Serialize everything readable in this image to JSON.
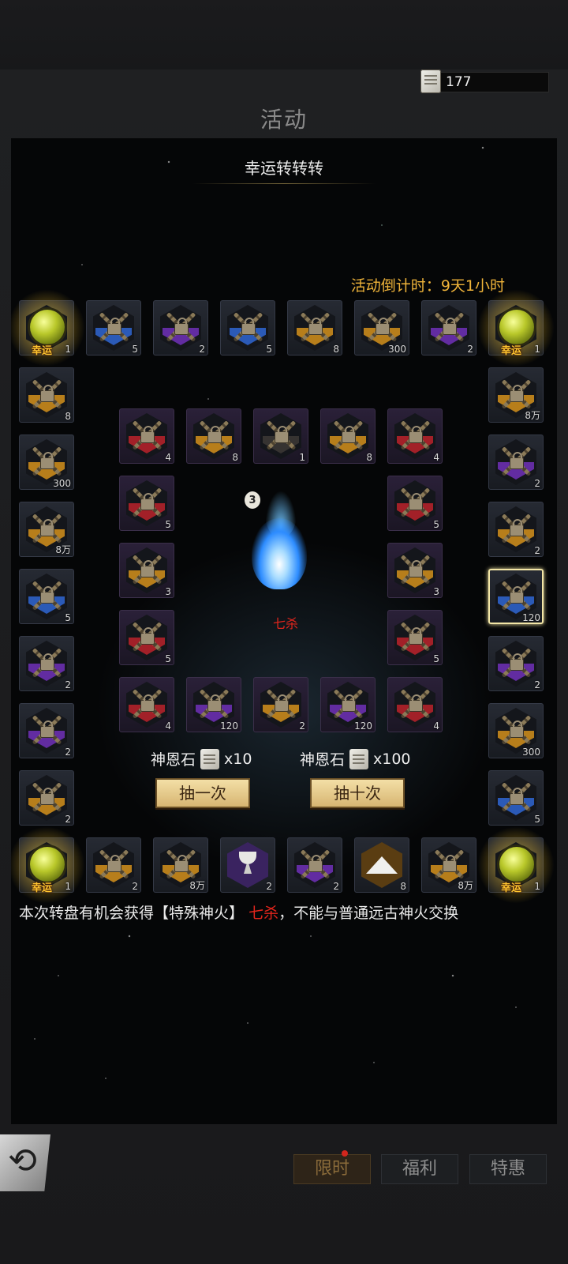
{
  "header": {
    "currency_value": "177",
    "title": "活动"
  },
  "panel": {
    "subtitle": "幸运转转转",
    "countdown_label": "活动倒计时：",
    "countdown_value": "9天1小时"
  },
  "luck_label": "幸运",
  "center": {
    "fire_level": "3",
    "fire_name": "七杀"
  },
  "draw_one": {
    "cost_label": "神恩石",
    "cost_amount": "x10",
    "button": "抽一次"
  },
  "draw_ten": {
    "cost_label": "神恩石",
    "cost_amount": "x100",
    "button": "抽十次"
  },
  "notice": {
    "before": "本次转盘有机会获得【特殊神火】",
    "highlight": "七杀",
    "after": "，不能与普通远古神火交换"
  },
  "tabs": [
    "限时",
    "福利",
    "特惠"
  ],
  "active_tab": "限时",
  "colors": {
    "gold": "#f0b43a",
    "blue": "#2e62c9",
    "purple": "#6a2fb0",
    "red": "#b1212a",
    "orange": "#c98a1c",
    "dark": "#3a3634",
    "highlight_red": "#e2251c"
  },
  "outer_ring": [
    {
      "type": "luck",
      "count": "1"
    },
    {
      "type": "locked",
      "tint": "blue",
      "count": "5"
    },
    {
      "type": "locked",
      "tint": "purple",
      "count": "2"
    },
    {
      "type": "locked",
      "tint": "blue",
      "count": "5"
    },
    {
      "type": "locked",
      "tint": "orange",
      "count": "8"
    },
    {
      "type": "locked",
      "tint": "orange",
      "count": "300"
    },
    {
      "type": "locked",
      "tint": "purple",
      "count": "2"
    },
    {
      "type": "luck",
      "count": "1"
    },
    {
      "type": "locked",
      "tint": "orange",
      "count": "8万"
    },
    {
      "type": "locked",
      "tint": "purple",
      "count": "2"
    },
    {
      "type": "locked",
      "tint": "orange",
      "count": "2"
    },
    {
      "type": "locked",
      "tint": "blue",
      "count": "120",
      "selected": true
    },
    {
      "type": "locked",
      "tint": "purple",
      "count": "2"
    },
    {
      "type": "locked",
      "tint": "orange",
      "count": "300"
    },
    {
      "type": "locked",
      "tint": "blue",
      "count": "5"
    },
    {
      "type": "luck",
      "count": "1"
    },
    {
      "type": "locked",
      "tint": "orange",
      "count": "8万"
    },
    {
      "type": "powder",
      "count": "8"
    },
    {
      "type": "locked",
      "tint": "purple",
      "count": "2"
    },
    {
      "type": "cup",
      "count": "2"
    },
    {
      "type": "locked",
      "tint": "orange",
      "count": "8万"
    },
    {
      "type": "locked",
      "tint": "orange",
      "count": "2"
    },
    {
      "type": "luck",
      "count": "1"
    },
    {
      "type": "locked",
      "tint": "orange",
      "count": "2"
    },
    {
      "type": "locked",
      "tint": "purple",
      "count": "2"
    },
    {
      "type": "locked",
      "tint": "purple",
      "count": "2"
    },
    {
      "type": "locked",
      "tint": "blue",
      "count": "5"
    },
    {
      "type": "locked",
      "tint": "orange",
      "count": "8万"
    },
    {
      "type": "locked",
      "tint": "orange",
      "count": "300"
    },
    {
      "type": "locked",
      "tint": "orange",
      "count": "8"
    }
  ],
  "inner_ring": [
    {
      "tint": "red",
      "count": "4"
    },
    {
      "tint": "orange",
      "count": "8"
    },
    {
      "tint": "dark",
      "count": "1"
    },
    {
      "tint": "orange",
      "count": "8"
    },
    {
      "tint": "red",
      "count": "4"
    },
    {
      "tint": "red",
      "count": "5"
    },
    {
      "tint": "orange",
      "count": "3"
    },
    {
      "tint": "red",
      "count": "5"
    },
    {
      "tint": "red",
      "count": "4"
    },
    {
      "tint": "purple",
      "count": "120"
    },
    {
      "tint": "orange",
      "count": "2"
    },
    {
      "tint": "purple",
      "count": "120"
    },
    {
      "tint": "red",
      "count": "4"
    },
    {
      "tint": "red",
      "count": "5"
    },
    {
      "tint": "orange",
      "count": "3"
    },
    {
      "tint": "red",
      "count": "5"
    }
  ]
}
